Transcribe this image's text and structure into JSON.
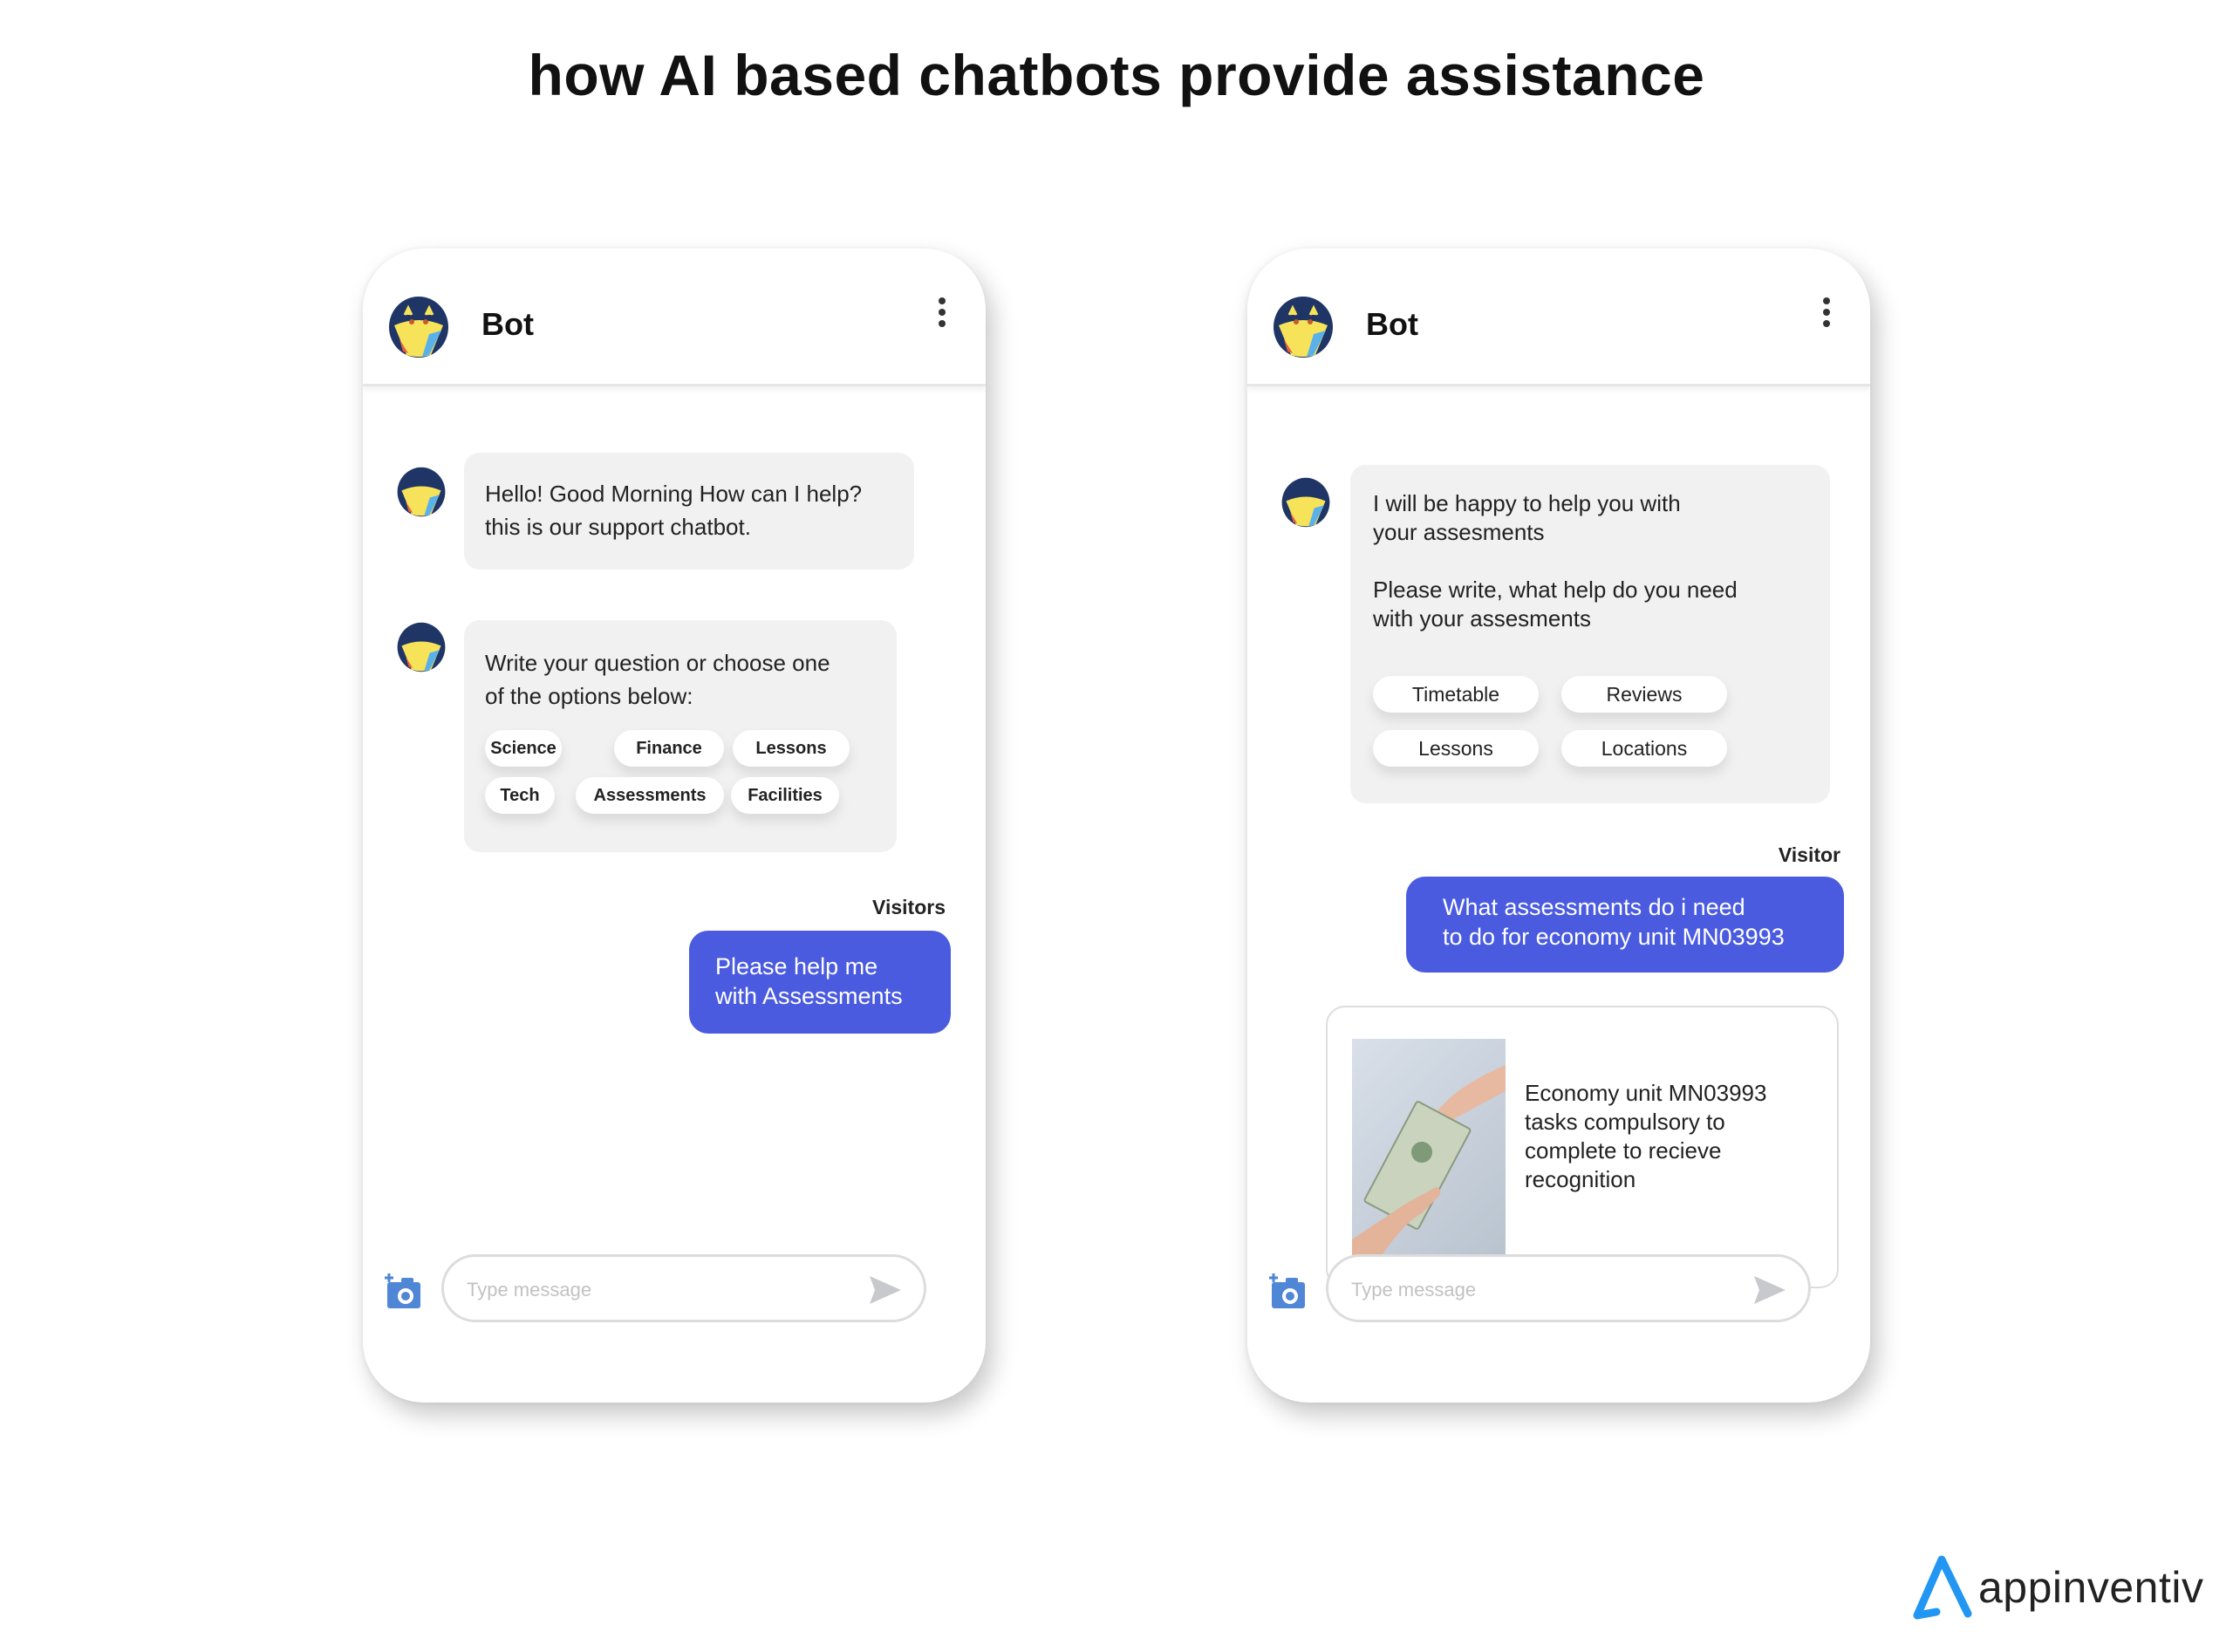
{
  "title": "how AI based chatbots provide assistance",
  "icons": {
    "bot_avatar": "bot-avatar-icon",
    "menu": "kebab-menu-icon",
    "camera": "camera-add-icon",
    "send": "send-icon",
    "logo": "appinventiv-logo-icon"
  },
  "colors": {
    "user_bubble": "#4a5be0",
    "bot_bubble": "#f1f1f1",
    "logo_blue": "#2196f3"
  },
  "left_phone": {
    "header": {
      "name": "Bot"
    },
    "messages": [
      {
        "from": "bot",
        "lines": [
          "Hello! Good Morning How can I help?",
          "this is our support chatbot."
        ]
      },
      {
        "from": "bot",
        "lines": [
          "Write your question or choose one",
          "of the options below:"
        ],
        "options": [
          "Science",
          "Finance",
          "Lessons",
          "Tech",
          "Assessments",
          "Facilities"
        ]
      }
    ],
    "user_label": "Visitors",
    "user_message": [
      "Please help me",
      "with Assessments"
    ],
    "compose": {
      "placeholder": "Type message"
    }
  },
  "right_phone": {
    "header": {
      "name": "Bot"
    },
    "bot_message": {
      "para1": [
        "I will be happy to help you with",
        "your assesments"
      ],
      "para2": [
        "Please write, what help do you need",
        "with your assesments"
      ],
      "options": [
        "Timetable",
        "Reviews",
        "Lessons",
        "Locations"
      ]
    },
    "user_label": "Visitor",
    "user_message": [
      "What assessments do i need",
      "to do for economy unit MN03993"
    ],
    "card": {
      "image_alt": "hands exchanging dollar bill",
      "lines": [
        "Economy unit MN03993",
        "tasks compulsory to",
        "complete to recieve",
        "recognition"
      ]
    },
    "compose": {
      "placeholder": "Type message"
    }
  },
  "brand": {
    "name": "appinventiv"
  }
}
